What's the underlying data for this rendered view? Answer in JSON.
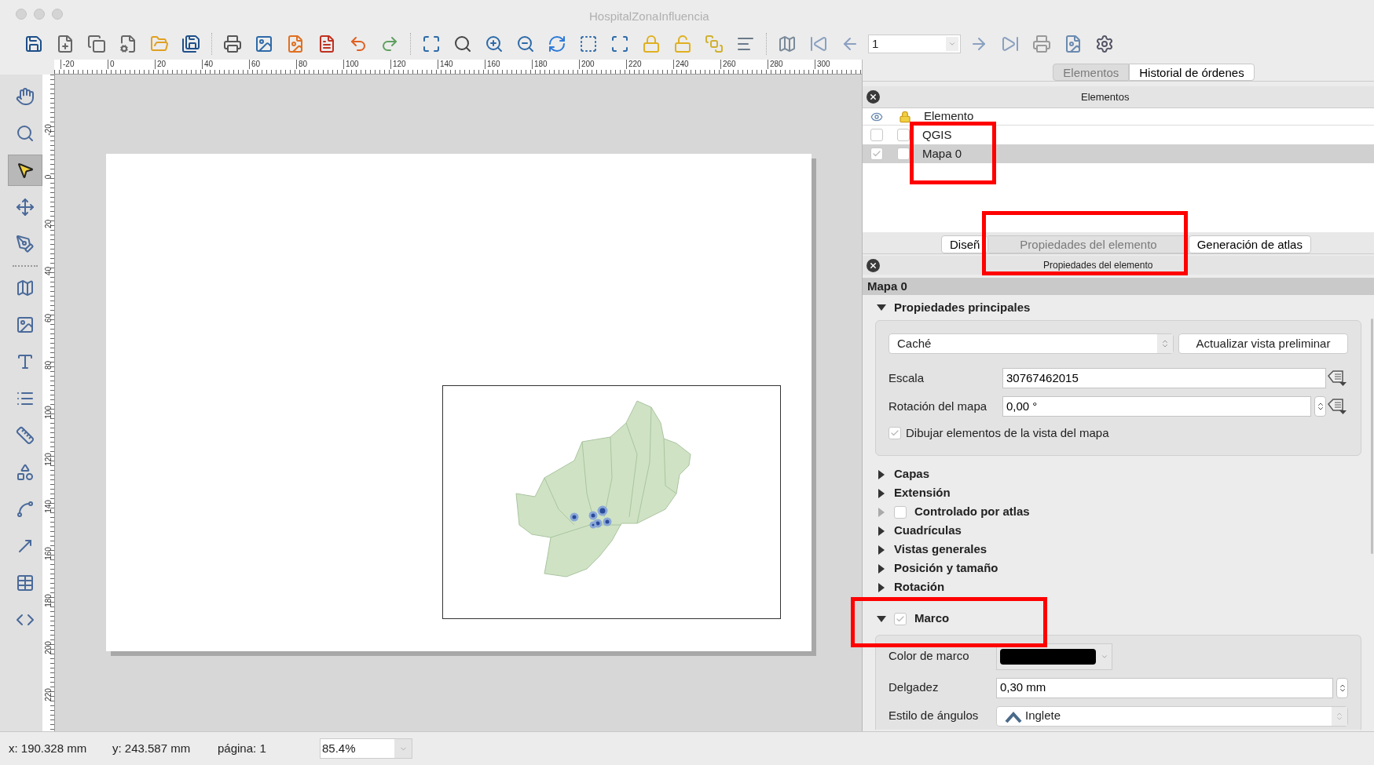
{
  "window": {
    "title": "HospitalZonaInfluencia"
  },
  "toolbar": {
    "page_field": "1"
  },
  "rulers": {
    "horizontal": [
      "-20",
      "0",
      "20",
      "40",
      "60",
      "80",
      "100",
      "120",
      "140",
      "160",
      "180",
      "200",
      "220",
      "240",
      "260",
      "280",
      "300"
    ],
    "vertical": [
      "-20",
      "0",
      "20",
      "40",
      "60",
      "80",
      "100",
      "120",
      "140",
      "160",
      "180",
      "200",
      "220"
    ]
  },
  "left_tools": [
    {
      "kind": "pan",
      "selected": false
    },
    {
      "kind": "zoom",
      "selected": false
    },
    {
      "kind": "select",
      "selected": true
    },
    {
      "kind": "move_content",
      "selected": false
    },
    {
      "kind": "edit_nodes",
      "selected": false
    },
    {
      "kind": "add_map",
      "selected": false,
      "separator_before": true
    },
    {
      "kind": "add_image",
      "selected": false
    },
    {
      "kind": "add_label",
      "selected": false
    },
    {
      "kind": "add_legend",
      "selected": false
    },
    {
      "kind": "add_scalebar",
      "selected": false
    },
    {
      "kind": "add_shape",
      "selected": false
    },
    {
      "kind": "add_polygon",
      "selected": false
    },
    {
      "kind": "add_arrow",
      "selected": false
    },
    {
      "kind": "add_table",
      "selected": false
    },
    {
      "kind": "add_html",
      "selected": false
    }
  ],
  "top_tabs": [
    {
      "label": "Elementos",
      "selected": true
    },
    {
      "label": "Historial de órdenes",
      "selected": false
    }
  ],
  "elements_panel": {
    "title": "Elementos",
    "header": "Elemento",
    "items": [
      {
        "name": "QGIS",
        "visible": false,
        "locked": false,
        "selected": false
      },
      {
        "name": "Mapa 0",
        "visible": true,
        "locked": false,
        "selected": true
      }
    ]
  },
  "bottom_tabs": [
    {
      "label": "Diseñ",
      "selected": false
    },
    {
      "label": "Propiedades del elemento",
      "selected": true
    },
    {
      "label": "Generación de atlas",
      "selected": false
    }
  ],
  "properties_panel": {
    "title": "Propiedades del elemento",
    "item_title": "Mapa 0",
    "sections": [
      {
        "kind": "main",
        "title": "Propiedades principales",
        "expanded": true,
        "cache_mode": "Caché",
        "refresh_button": "Actualizar vista preliminar",
        "scale_label": "Escala",
        "scale_value": "30767462015",
        "rotation_label": "Rotación del mapa",
        "rotation_value": "0,00 °",
        "draw_items_label": "Dibujar elementos de la vista del mapa",
        "draw_items_checked": true
      },
      {
        "kind": "plain",
        "title": "Capas",
        "expanded": false
      },
      {
        "kind": "plain",
        "title": "Extensión",
        "expanded": false
      },
      {
        "kind": "checkable",
        "title": "Controlado por atlas",
        "expanded": false,
        "checked": false
      },
      {
        "kind": "plain",
        "title": "Cuadrículas",
        "expanded": false
      },
      {
        "kind": "plain",
        "title": "Vistas generales",
        "expanded": false
      },
      {
        "kind": "plain",
        "title": "Posición y tamaño",
        "expanded": false
      },
      {
        "kind": "plain",
        "title": "Rotación",
        "expanded": false
      },
      {
        "kind": "frame",
        "title": "Marco",
        "expanded": true,
        "checked": true,
        "color_label": "Color de marco",
        "color": "#000000",
        "thickness_label": "Delgadez",
        "thickness_value": "0,30 mm",
        "join_label": "Estilo de ángulos",
        "join_value": "Inglete"
      }
    ]
  },
  "status_bar": {
    "x": "x: 190.328 mm",
    "y": "y: 243.587 mm",
    "page": "página: 1",
    "zoom": "85.4%"
  }
}
